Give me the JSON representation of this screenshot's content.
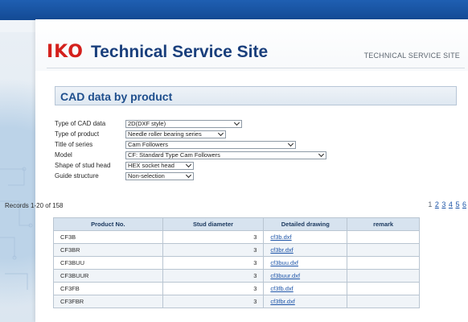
{
  "header": {
    "logo": "IKO",
    "title": "Technical Service Site",
    "right_text": "TECHNICAL SERVICE SITE"
  },
  "section": {
    "title": "CAD data by product"
  },
  "form": {
    "fields": [
      {
        "label": "Type of CAD data",
        "value": "2D(DXF style)"
      },
      {
        "label": "Type of product",
        "value": "Needle roller bearing series"
      },
      {
        "label": "Title of series",
        "value": "Cam Followers"
      },
      {
        "label": "Model",
        "value": "CF: Standard Type Cam Followers"
      },
      {
        "label": "Shape of stud head",
        "value": "HEX socket head"
      },
      {
        "label": "Guide structure",
        "value": "Non-selection"
      }
    ]
  },
  "records": "Records 1-20 of 158",
  "pager": {
    "current": "1",
    "pages": [
      "2",
      "3",
      "4",
      "5",
      "6"
    ]
  },
  "table": {
    "headers": [
      "Product No.",
      "Stud diameter",
      "Detailed drawing",
      "remark"
    ],
    "rows": [
      {
        "product": "CF3B",
        "stud": "3",
        "drawing": "cf3b.dxf",
        "remark": ""
      },
      {
        "product": "CF3BR",
        "stud": "3",
        "drawing": "cf3br.dxf",
        "remark": ""
      },
      {
        "product": "CF3BUU",
        "stud": "3",
        "drawing": "cf3buu.dxf",
        "remark": ""
      },
      {
        "product": "CF3BUUR",
        "stud": "3",
        "drawing": "cf3buur.dxf",
        "remark": ""
      },
      {
        "product": "CF3FB",
        "stud": "3",
        "drawing": "cf3fb.dxf",
        "remark": ""
      },
      {
        "product": "CF3FBR",
        "stud": "3",
        "drawing": "cf3fbr.dxf",
        "remark": ""
      }
    ]
  }
}
